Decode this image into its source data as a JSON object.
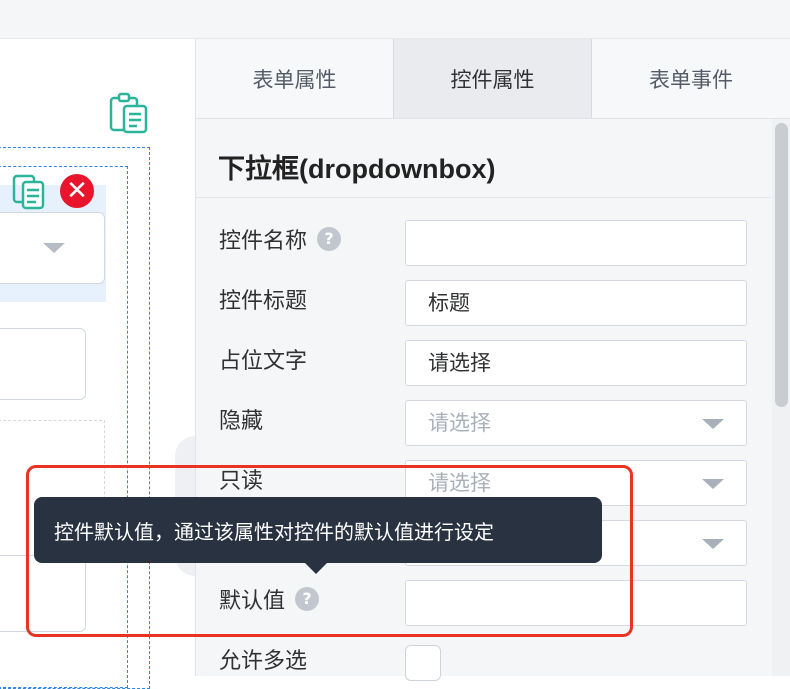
{
  "tabs": [
    {
      "label": "表单属性"
    },
    {
      "label": "控件属性",
      "active": true
    },
    {
      "label": "表单事件"
    }
  ],
  "props": {
    "title": "下拉框(dropdownbox)",
    "rows": [
      {
        "label": "控件名称",
        "help": true,
        "value": ""
      },
      {
        "label": "控件标题",
        "value": "标题"
      },
      {
        "label": "占位文字",
        "value": "请选择"
      },
      {
        "label": "隐藏",
        "placeholder": "请选择",
        "dropdown": true
      },
      {
        "label": "只读",
        "placeholder": "请选择",
        "dropdown": true
      },
      {
        "label": "",
        "placeholder": "",
        "dropdown": true
      },
      {
        "label": "默认值",
        "help": true,
        "value": ""
      },
      {
        "label": "允许多选",
        "checkbox": true
      }
    ]
  },
  "tooltip": {
    "text": "控件默认值，通过该属性对控件的默认值进行设定"
  },
  "canvas": {
    "close_glyph": "✕"
  },
  "icons": {
    "copy": "copy-icon",
    "close": "close-icon",
    "help": "help-icon",
    "dropdown": "chevron-down-icon"
  },
  "colors": {
    "accent_blue": "#2f83e8",
    "danger_red": "#e8152d",
    "highlight_red": "#ea3323",
    "tooltip_bg": "#283240",
    "copy_green": "#2bb49a"
  }
}
